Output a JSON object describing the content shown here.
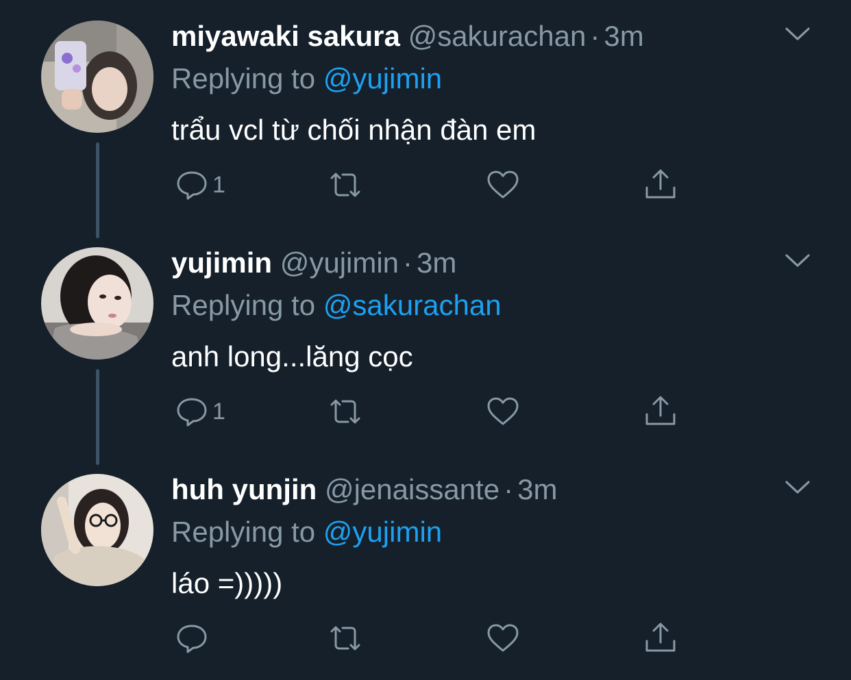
{
  "colors": {
    "background": "#15202b",
    "text": "#ffffff",
    "muted": "#8899a6",
    "link": "#1da1f2",
    "thread_line": "#3d5466"
  },
  "tweets": [
    {
      "name": "miyawaki sakura",
      "handle": "@sakurachan",
      "separator": "·",
      "time": "3m",
      "reply_prefix": "Replying to",
      "reply_to": "@yujimin",
      "text": "trẩu vcl từ chối nhận đàn em",
      "reply_count": "1",
      "retweet_count": "",
      "like_count": "",
      "icons": [
        "reply-icon",
        "retweet-icon",
        "like-icon",
        "share-icon",
        "chevron-down-icon"
      ]
    },
    {
      "name": "yujimin",
      "handle": "@yujimin",
      "separator": "·",
      "time": "3m",
      "reply_prefix": "Replying to",
      "reply_to": "@sakurachan",
      "text": "anh long...lăng cọc",
      "reply_count": "1",
      "retweet_count": "",
      "like_count": "",
      "icons": [
        "reply-icon",
        "retweet-icon",
        "like-icon",
        "share-icon",
        "chevron-down-icon"
      ]
    },
    {
      "name": "huh yunjin",
      "handle": "@jenaissante",
      "separator": "·",
      "time": "3m",
      "reply_prefix": "Replying to",
      "reply_to": "@yujimin",
      "text": "láo =)))))",
      "reply_count": "",
      "retweet_count": "",
      "like_count": "",
      "icons": [
        "reply-icon",
        "retweet-icon",
        "like-icon",
        "share-icon",
        "chevron-down-icon"
      ]
    }
  ]
}
